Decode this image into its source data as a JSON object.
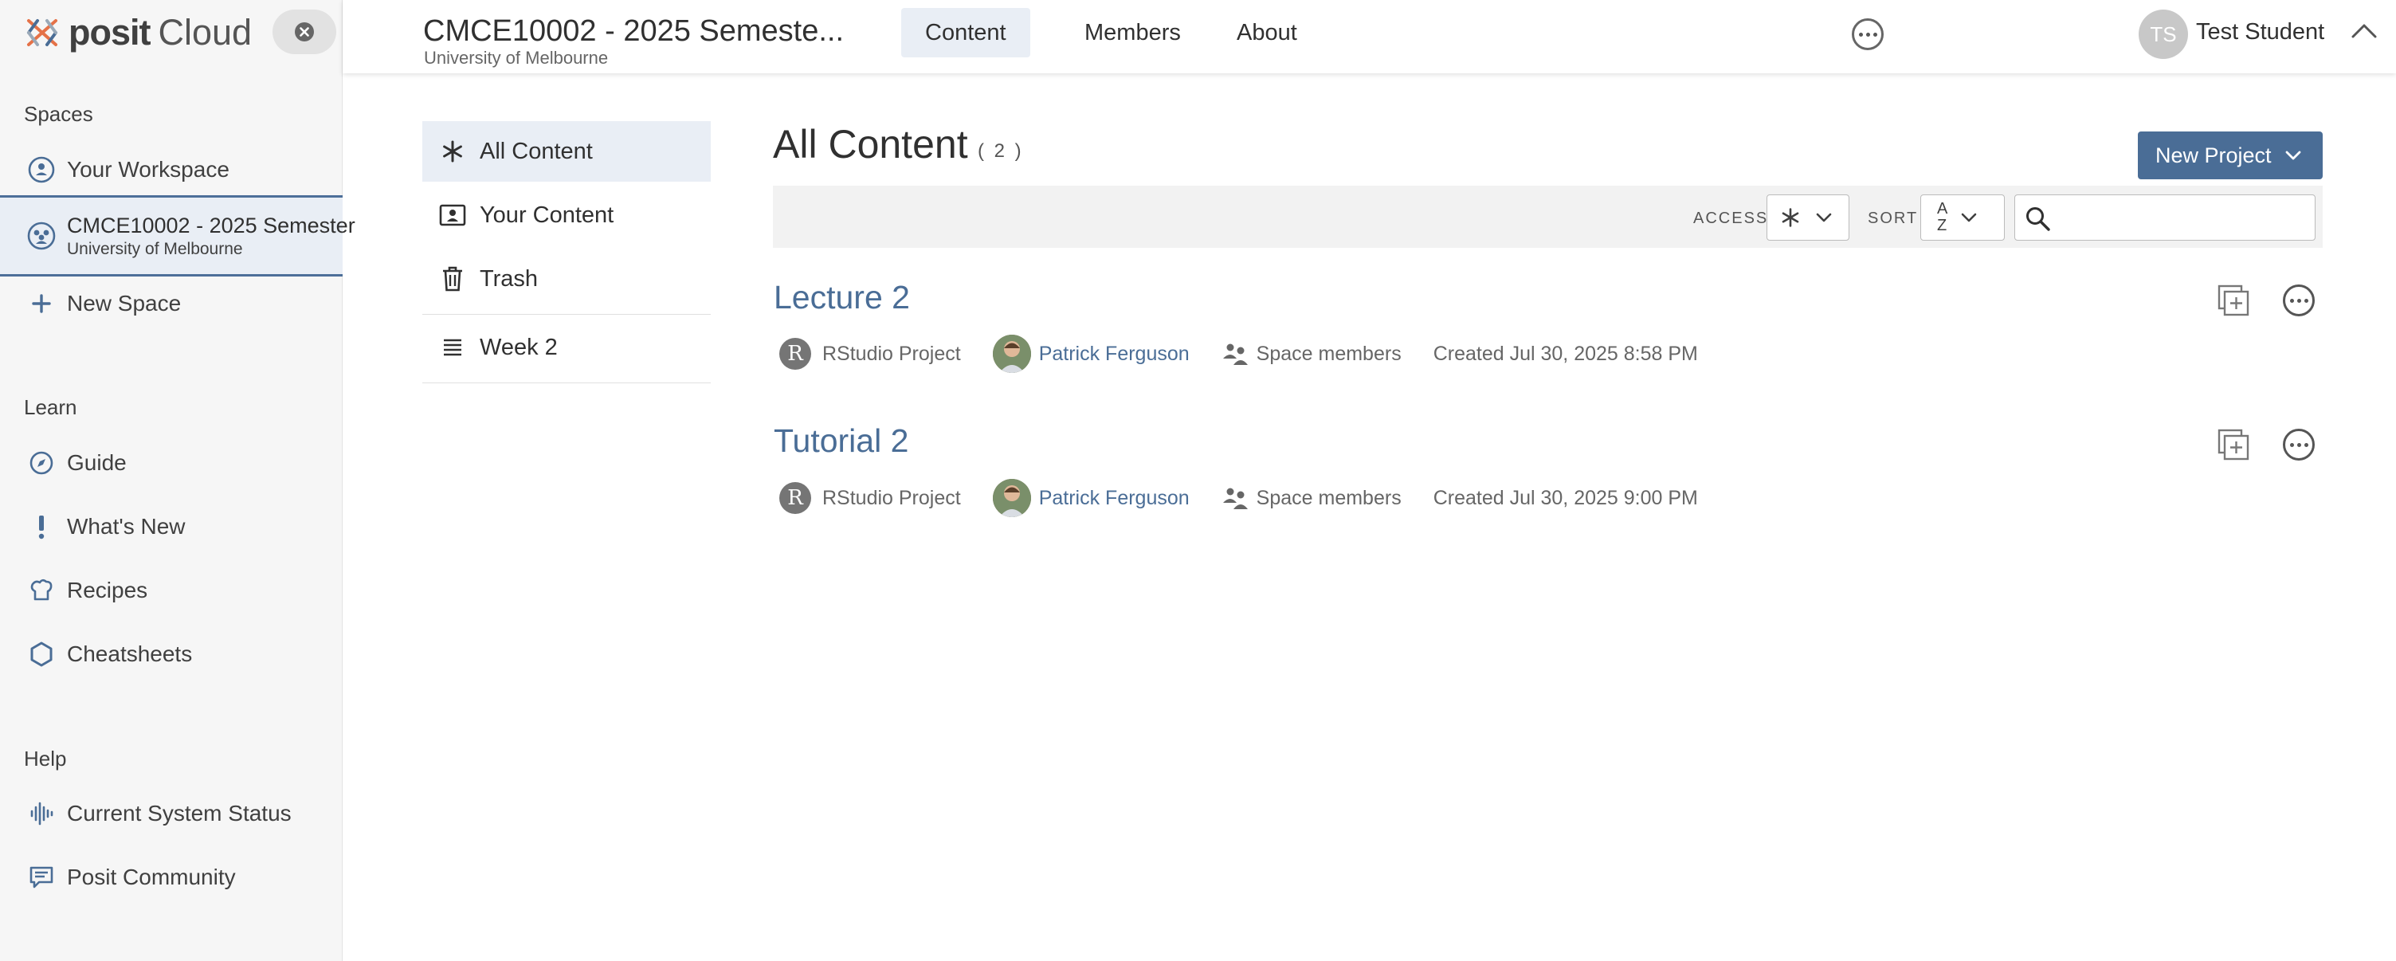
{
  "brand": {
    "name": "posit",
    "product": "Cloud"
  },
  "sidebar": {
    "spaces_heading": "Spaces",
    "your_workspace": "Your Workspace",
    "active_space": {
      "name": "CMCE10002 - 2025 Semester",
      "org": "University of Melbourne"
    },
    "new_space": "New Space",
    "learn_heading": "Learn",
    "learn_items": [
      "Guide",
      "What's New",
      "Recipes",
      "Cheatsheets"
    ],
    "help_heading": "Help",
    "help_items": [
      "Current System Status",
      "Posit Community"
    ]
  },
  "header": {
    "space_title": "CMCE10002 - 2025 Semeste...",
    "space_org": "University of Melbourne",
    "tabs": [
      "Content",
      "Members",
      "About"
    ],
    "active_tab": "Content",
    "user_initials": "TS",
    "user_name": "Test Student"
  },
  "filters": {
    "items": [
      "All Content",
      "Your Content",
      "Trash",
      "Week 2"
    ],
    "active": "All Content"
  },
  "main": {
    "title": "All Content",
    "count": "( 2 )",
    "new_project_label": "New Project",
    "access_label": "ACCESS",
    "sort_label": "SORT",
    "sort_value_top": "A",
    "sort_value_bottom": "Z",
    "search_placeholder": ""
  },
  "projects": [
    {
      "title": "Lecture 2",
      "type_badge": "R",
      "type": "RStudio Project",
      "author": "Patrick Ferguson",
      "access": "Space members",
      "created": "Created Jul 30, 2025 8:58 PM"
    },
    {
      "title": "Tutorial 2",
      "type_badge": "R",
      "type": "RStudio Project",
      "author": "Patrick Ferguson",
      "access": "Space members",
      "created": "Created Jul 30, 2025 9:00 PM"
    }
  ],
  "colors": {
    "accent": "#4a6d96",
    "active_bg": "#e9eef5",
    "sidebar_bg": "#f6f6f6",
    "toolbar_bg": "#f2f2f2"
  },
  "icons": {
    "logo": "posit-logo-icon",
    "close": "close-circle-icon",
    "workspace": "person-circle-icon",
    "space": "people-circle-icon",
    "new_space": "plus-icon",
    "guide": "compass-icon",
    "whats_new": "exclamation-icon",
    "recipes": "chef-hat-icon",
    "cheatsheets": "hexagon-icon",
    "status": "waveform-icon",
    "community": "chat-bubble-icon"
  }
}
